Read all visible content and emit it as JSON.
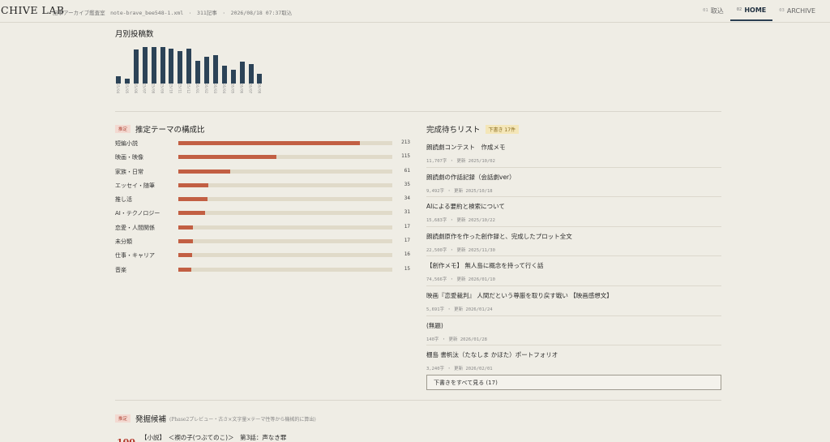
{
  "header": {
    "brand": "CHIVE LAB",
    "meta": "記事アーカイブ鑑査室　note-brave_bee548-1.xml　·　311記事　·　2026/08/18 07:37取込",
    "nav": [
      {
        "num": "01",
        "label": "取込"
      },
      {
        "num": "02",
        "label": "HOME"
      },
      {
        "num": "03",
        "label": "ARCHIVE"
      }
    ]
  },
  "monthly": {
    "title": "月別投稿数",
    "chart_data": {
      "type": "bar",
      "categories": [
        "25/04",
        "25/05",
        "25/06",
        "25/07",
        "25/08",
        "25/09",
        "25/10",
        "25/11",
        "25/12",
        "26/01",
        "26/02",
        "26/03",
        "26/04",
        "26/05",
        "26/06",
        "26/07",
        "26/08"
      ],
      "values": [
        8,
        5,
        37,
        40,
        40,
        40,
        38,
        36,
        38,
        25,
        29,
        31,
        20,
        15,
        24,
        21,
        11
      ],
      "colors": {
        "bar": "#2c4357"
      }
    }
  },
  "themes": {
    "badge": "推定",
    "title": "推定テーマの構成比",
    "max": 213,
    "items": [
      {
        "label": "短編小説",
        "count": 213
      },
      {
        "label": "映画・映像",
        "count": 115
      },
      {
        "label": "家族・日常",
        "count": 61
      },
      {
        "label": "エッセイ・随筆",
        "count": 35
      },
      {
        "label": "推し活",
        "count": 34
      },
      {
        "label": "AI・テクノロジー",
        "count": 31
      },
      {
        "label": "恋愛・人間関係",
        "count": 17
      },
      {
        "label": "未分類",
        "count": 17
      },
      {
        "label": "仕事・キャリア",
        "count": 16
      },
      {
        "label": "音楽",
        "count": 15
      }
    ],
    "colors": {
      "fill": "#c25f43",
      "track": "#e0dac9"
    }
  },
  "drafts": {
    "title": "完成待ちリスト",
    "badge": "下書き 17件",
    "items": [
      {
        "title": "朗読劇コンテスト　作成メモ",
        "meta": "11,707字 ・ 更新 2025/10/02"
      },
      {
        "title": "朗読劇の作話記録（会話劇ver）",
        "meta": "9,492字 ・ 更新 2025/10/18"
      },
      {
        "title": "AIによる要約と検索について",
        "meta": "15,683字 ・ 更新 2025/10/22"
      },
      {
        "title": "朗読劇原作を作った創作録と、完成したプロット全文",
        "meta": "22,500字 ・ 更新 2025/11/30"
      },
      {
        "title": "【創作メモ】 無人島に概念を持って行く話",
        "meta": "74,566字 ・ 更新 2026/01/10"
      },
      {
        "title": "映画『恋愛裁判』 人間だという尊厳を取り戻す戦い 【映画感想文】",
        "meta": "5,691字 ・ 更新 2026/01/24"
      },
      {
        "title": "(無題)",
        "meta": "140字 ・ 更新 2026/01/28"
      },
      {
        "title": "棚島 書帆汰（たなしま かほた）ポートフォリオ",
        "meta": "3,240字 ・ 更新 2026/02/01"
      }
    ],
    "show_all": "下書きをすべて見る (17)"
  },
  "dig": {
    "badge": "推定",
    "title": "発掘候補",
    "subtitle": "(Phase2プレビュー・古さ×文字量×テーマ性等から機械的に算出)",
    "score": "100",
    "first_item": "【小説】　＜禊の子(つぶてのこ)＞　第3話：声なき罪"
  }
}
